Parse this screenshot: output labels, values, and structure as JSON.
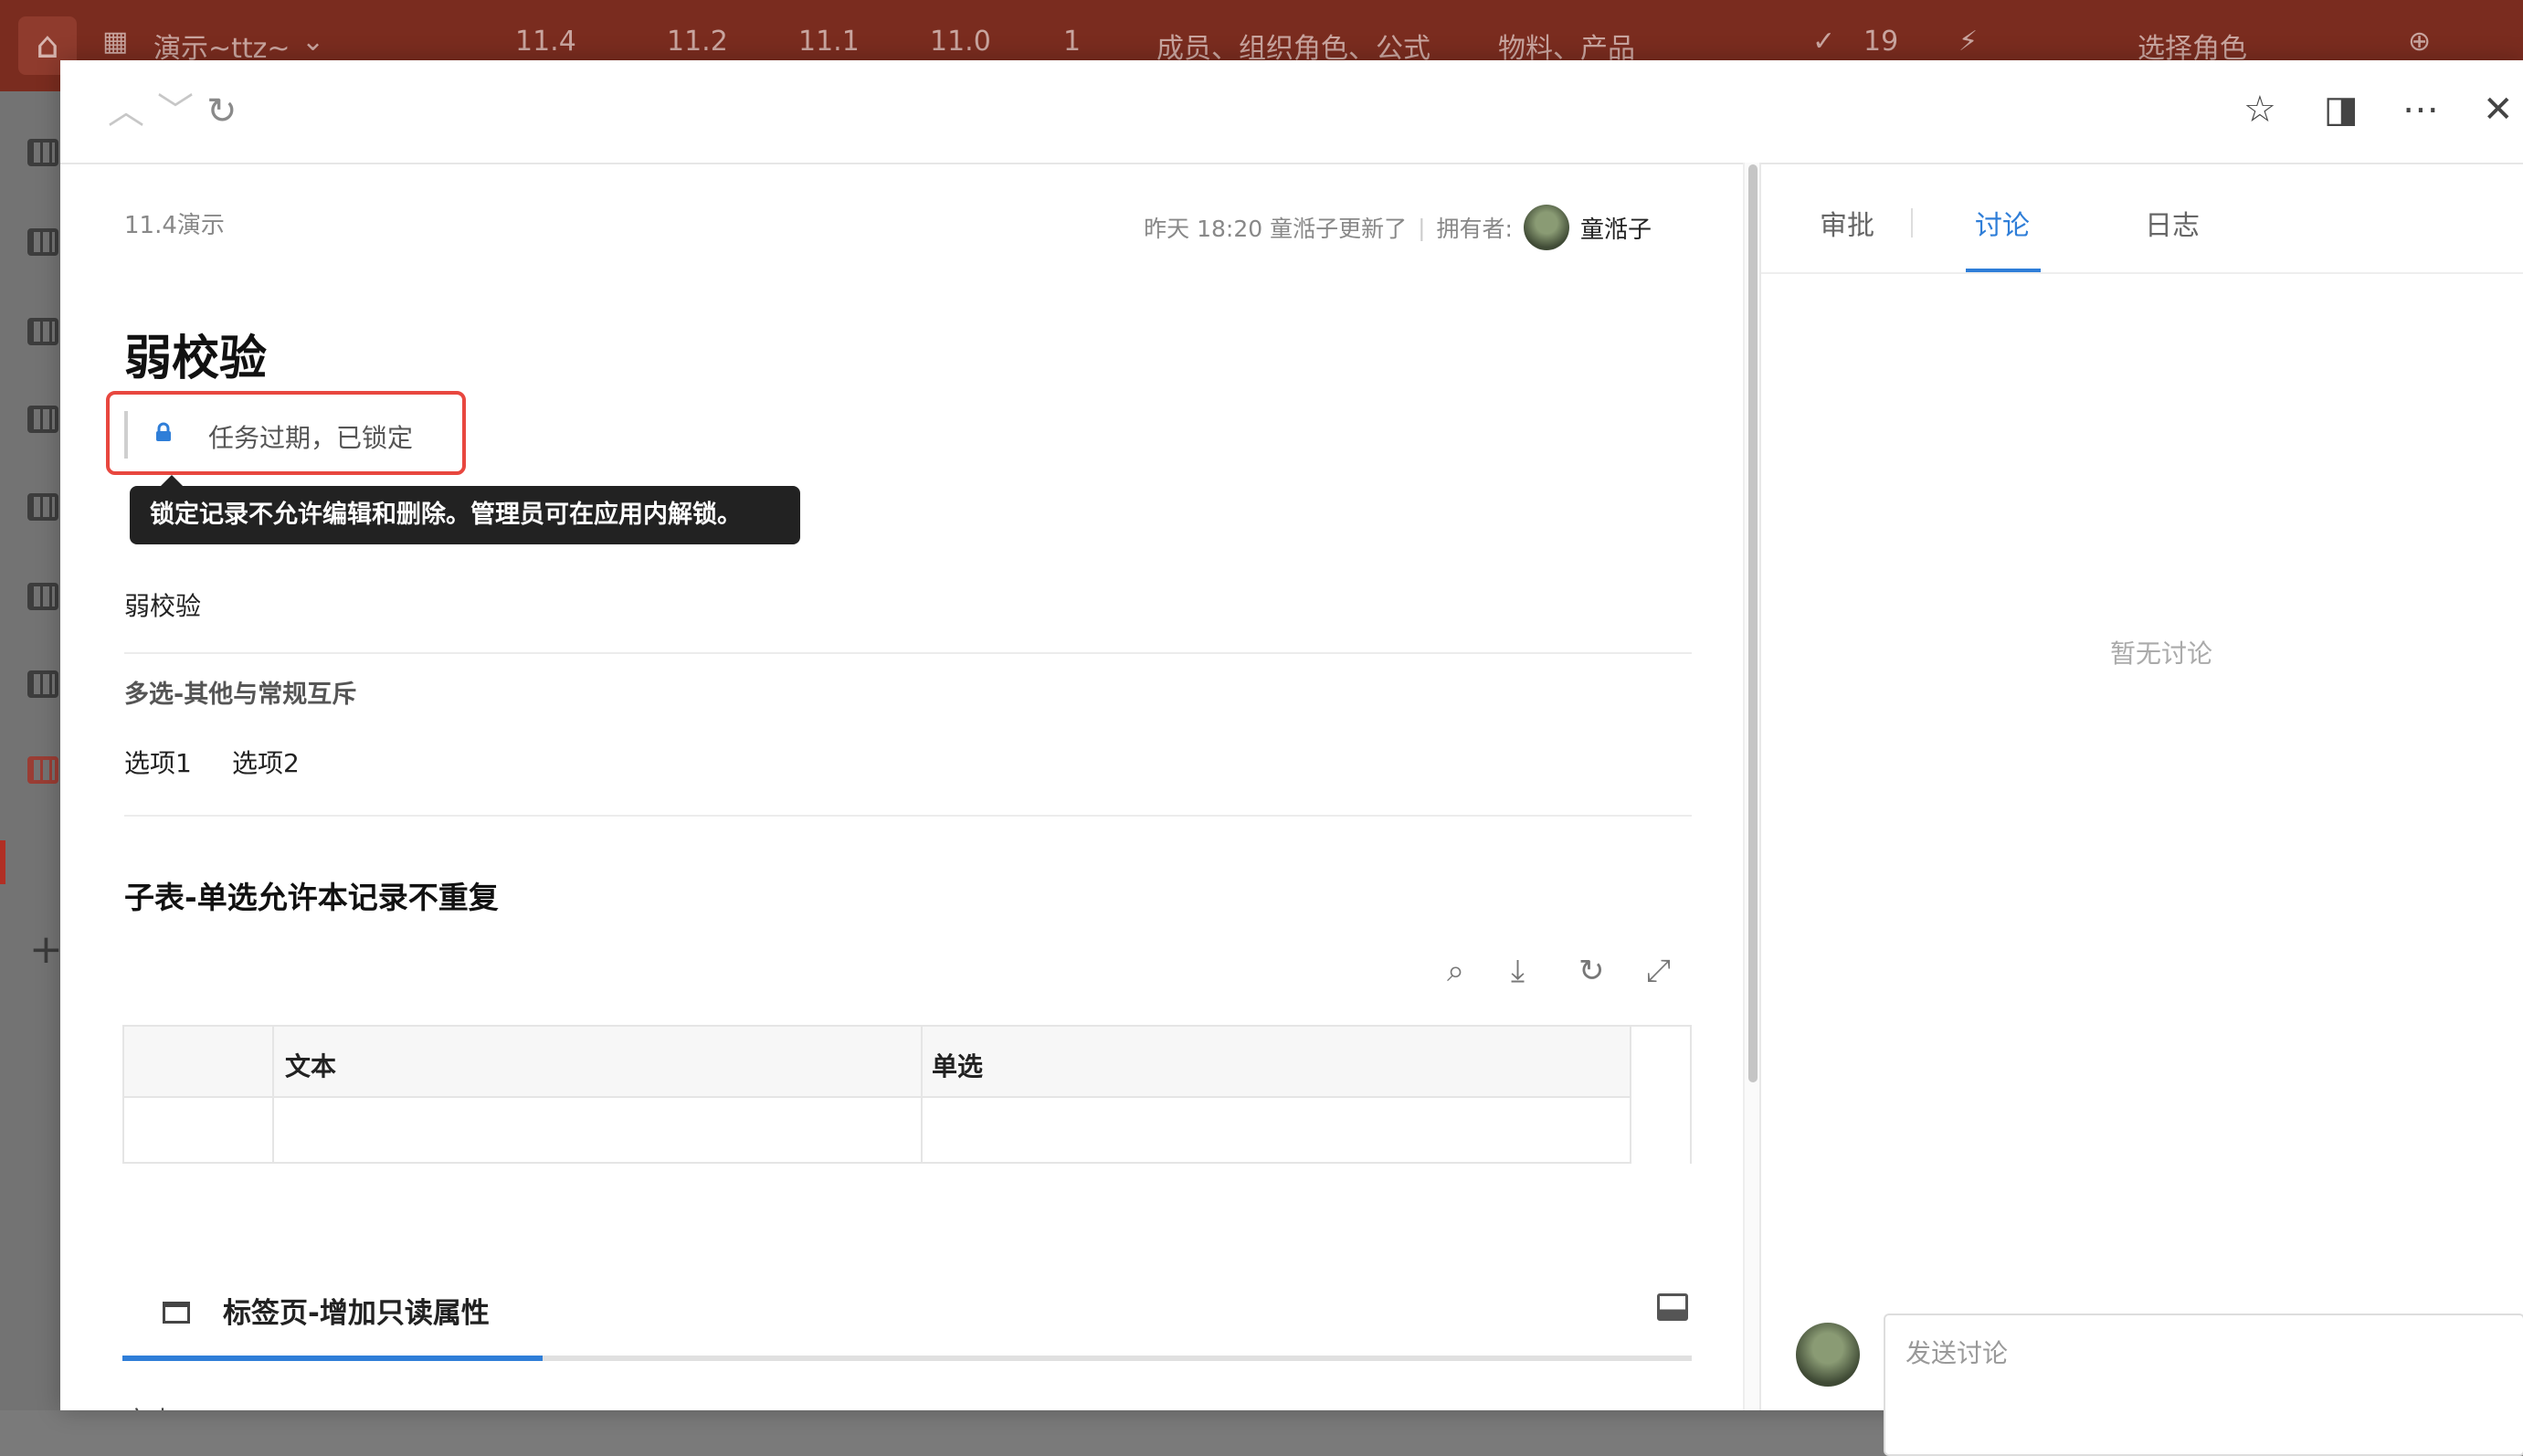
{
  "topbar": {
    "app_name": "演示~ttz~",
    "tabs": [
      "11.4",
      "11.2",
      "11.1",
      "11.0",
      "1",
      "成员、组织角色、公式",
      "物料、产品"
    ],
    "badge_count": "19",
    "role_select": "选择角色"
  },
  "record": {
    "breadcrumb": "11.4演示",
    "updated_text": "昨天 18:20 童湉子更新了",
    "owner_label": "拥有者:",
    "owner_name": "童湉子",
    "title": "弱校验",
    "lock_status": "任务过期，已锁定",
    "lock_tooltip": "锁定记录不允许编辑和删除。管理员可在应用内解锁。",
    "field1_value": "弱校验",
    "field2_label": "多选-其他与常规互斥",
    "field2_options": [
      "选项1",
      "选项2"
    ],
    "subtable_title": "子表-单选允许本记录不重复",
    "subtable_columns": [
      "文本",
      "单选"
    ],
    "tabpage_title": "标签页-增加只读属性",
    "tabpage_field_label": "文本"
  },
  "side_panel": {
    "tabs": [
      "审批",
      "讨论",
      "日志"
    ],
    "active_tab": "讨论",
    "empty_text": "暂无讨论",
    "comment_placeholder": "发送讨论"
  },
  "colors": {
    "topbar": "#7a2c1f",
    "accent": "#2f7ed8",
    "highlight_border": "#e8473f"
  }
}
